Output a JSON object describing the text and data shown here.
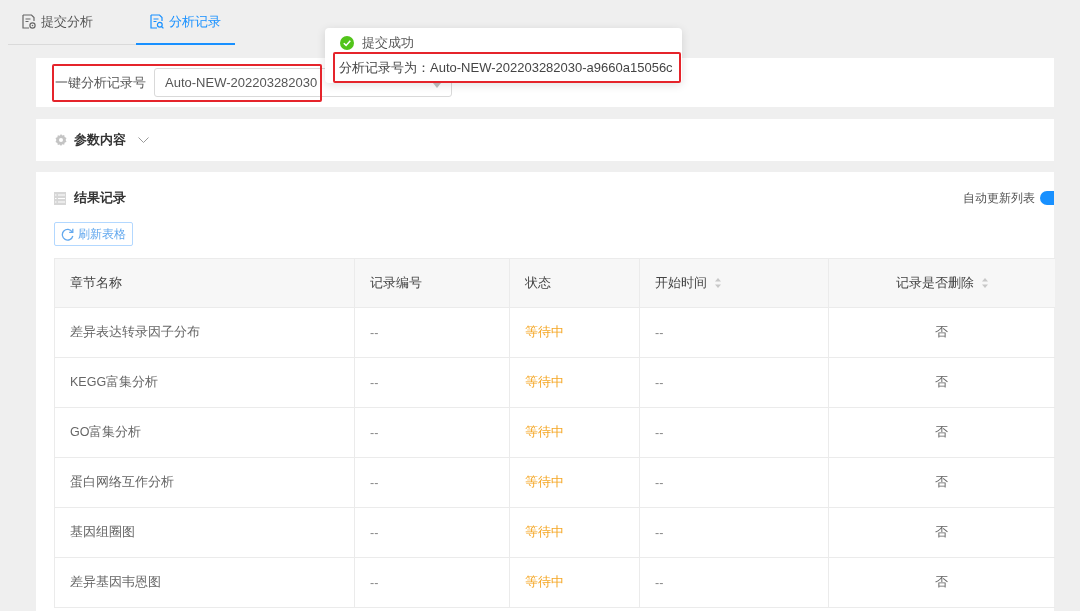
{
  "tabs": [
    {
      "label": "提交分析",
      "selected": false
    },
    {
      "label": "分析记录",
      "selected": true
    }
  ],
  "record_selector": {
    "label": "一键分析记录号",
    "value": "Auto-NEW-202203282030"
  },
  "toast": {
    "title": "提交成功",
    "message": "分析记录号为：Auto-NEW-202203282030-a9660a15056c"
  },
  "params": {
    "title": "参数内容",
    "expanded": false
  },
  "results": {
    "title": "结果记录",
    "auto_refresh": {
      "label": "自动更新列表",
      "on": true
    },
    "refresh_button": "刷新表格",
    "table": {
      "columns": [
        {
          "label": "章节名称",
          "sortable": false
        },
        {
          "label": "记录编号",
          "sortable": false
        },
        {
          "label": "状态",
          "sortable": false
        },
        {
          "label": "开始时间",
          "sortable": true
        },
        {
          "label": "记录是否删除",
          "sortable": true
        }
      ],
      "rows": [
        {
          "chapter": "差异表达转录因子分布",
          "record_id": "--",
          "status": {
            "label": "等待中",
            "kind": "waiting"
          },
          "start_time": "--",
          "deleted": "否"
        },
        {
          "chapter": "KEGG富集分析",
          "record_id": "--",
          "status": {
            "label": "等待中",
            "kind": "waiting"
          },
          "start_time": "--",
          "deleted": "否"
        },
        {
          "chapter": "GO富集分析",
          "record_id": "--",
          "status": {
            "label": "等待中",
            "kind": "waiting"
          },
          "start_time": "--",
          "deleted": "否"
        },
        {
          "chapter": "蛋白网络互作分析",
          "record_id": "--",
          "status": {
            "label": "等待中",
            "kind": "waiting"
          },
          "start_time": "--",
          "deleted": "否"
        },
        {
          "chapter": "基因组圈图",
          "record_id": "--",
          "status": {
            "label": "等待中",
            "kind": "waiting"
          },
          "start_time": "--",
          "deleted": "否"
        },
        {
          "chapter": "差异基因韦恩图",
          "record_id": "--",
          "status": {
            "label": "等待中",
            "kind": "waiting"
          },
          "start_time": "--",
          "deleted": "否"
        }
      ]
    }
  }
}
